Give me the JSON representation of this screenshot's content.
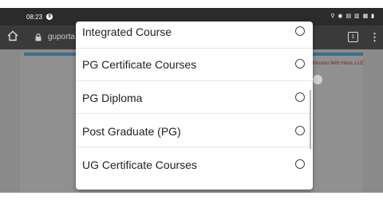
{
  "status_bar": {
    "time": "08:23",
    "notification_badge": "9",
    "icons": "⚲ ◉ ▤ ▥ ▦ ▮"
  },
  "browser": {
    "url": "guporta",
    "tab_count": "1",
    "menu_glyph": "⋮"
  },
  "page": {
    "side_text": "Mission With Hans, LLE"
  },
  "options": [
    {
      "label": "Integrated Course",
      "selected": false
    },
    {
      "label": "PG Certificate Courses",
      "selected": false
    },
    {
      "label": "PG Diploma",
      "selected": false
    },
    {
      "label": "Post Graduate (PG)",
      "selected": false
    },
    {
      "label": "UG Certificate Courses",
      "selected": false
    }
  ],
  "colors": {
    "overlay": "#8a8a8a",
    "sheet": "#ffffff",
    "accent_strip": "#3a6e86"
  }
}
